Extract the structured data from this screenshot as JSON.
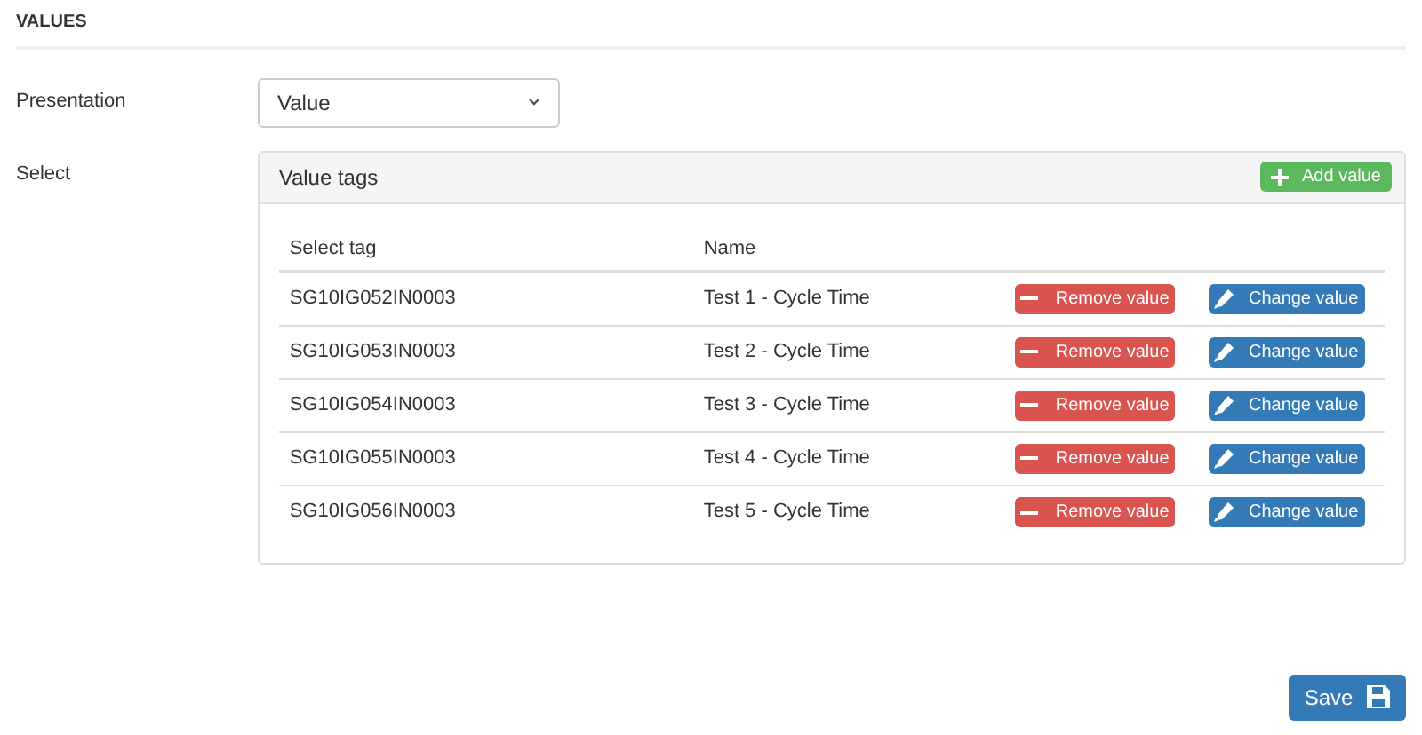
{
  "section_title": "VALUES",
  "presentation": {
    "label": "Presentation",
    "value": "Value"
  },
  "select": {
    "label": "Select",
    "panel_title": "Value tags",
    "add_button": "Add value",
    "columns": [
      "Select tag",
      "Name"
    ],
    "rows": [
      {
        "tag": "SG10IG052IN0003",
        "name": "Test 1 - Cycle Time",
        "remove": "Remove value",
        "change": "Change value"
      },
      {
        "tag": "SG10IG053IN0003",
        "name": "Test 2 - Cycle Time",
        "remove": "Remove value",
        "change": "Change value"
      },
      {
        "tag": "SG10IG054IN0003",
        "name": "Test 3 - Cycle Time",
        "remove": "Remove value",
        "change": "Change value"
      },
      {
        "tag": "SG10IG055IN0003",
        "name": "Test 4 - Cycle Time",
        "remove": "Remove value",
        "change": "Change value"
      },
      {
        "tag": "SG10IG056IN0003",
        "name": "Test 5 - Cycle Time",
        "remove": "Remove value",
        "change": "Change value"
      }
    ]
  },
  "save_button": "Save"
}
